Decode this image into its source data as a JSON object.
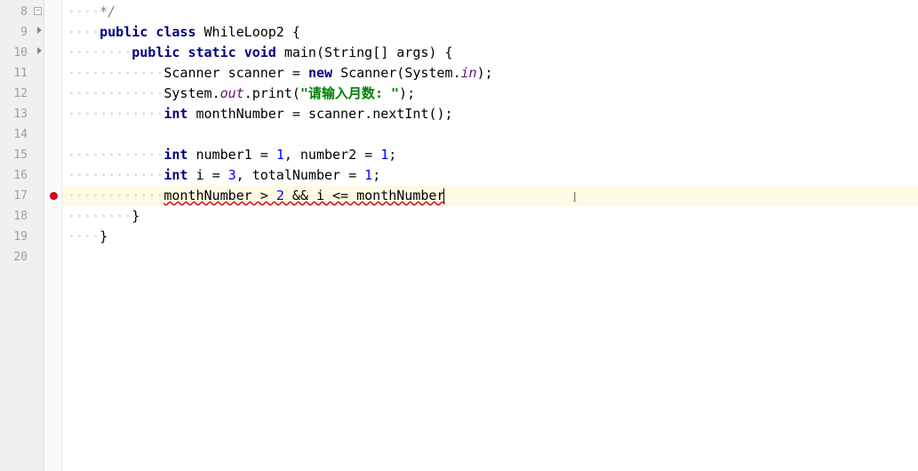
{
  "lines": [
    {
      "n": "8"
    },
    {
      "n": "9"
    },
    {
      "n": "10"
    },
    {
      "n": "11"
    },
    {
      "n": "12"
    },
    {
      "n": "13"
    },
    {
      "n": "14"
    },
    {
      "n": "15"
    },
    {
      "n": "16"
    },
    {
      "n": "17"
    },
    {
      "n": "18"
    },
    {
      "n": "19"
    },
    {
      "n": "20"
    }
  ],
  "code": {
    "l8": "*/",
    "kw_public": "public",
    "kw_class": "class",
    "cls_WhileLoop2": "WhileLoop2",
    "kw_static": "static",
    "kw_void": "void",
    "mth_main": "main",
    "cls_String": "String",
    "param_args": "args",
    "cls_Scanner": "Scanner",
    "var_scanner": "scanner",
    "kw_new": "new",
    "cls_System": "System",
    "field_in": "in",
    "field_out": "out",
    "mth_print": "print",
    "str_prompt": "\"请输入月数: \"",
    "kw_int": "int",
    "var_monthNumber": "monthNumber",
    "mth_nextInt": "nextInt",
    "var_number1": "number1",
    "var_number2": "number2",
    "num_1": "1",
    "var_i": "i",
    "num_3": "3",
    "var_totalNumber": "totalNumber",
    "num_2": "2",
    "err_line": "monthNumber > 2 && i <= monthNumber",
    "op_gt": ">",
    "op_and": "&&",
    "op_lte": "<=",
    "brace_open": "{",
    "brace_close": "}",
    "paren_open": "(",
    "paren_close": ")",
    "semi": ";",
    "comma": ",",
    "eq": "=",
    "brackets": "[]",
    "dot": ".",
    "indent1": "····",
    "indent2": "····",
    "indent3": "····"
  }
}
